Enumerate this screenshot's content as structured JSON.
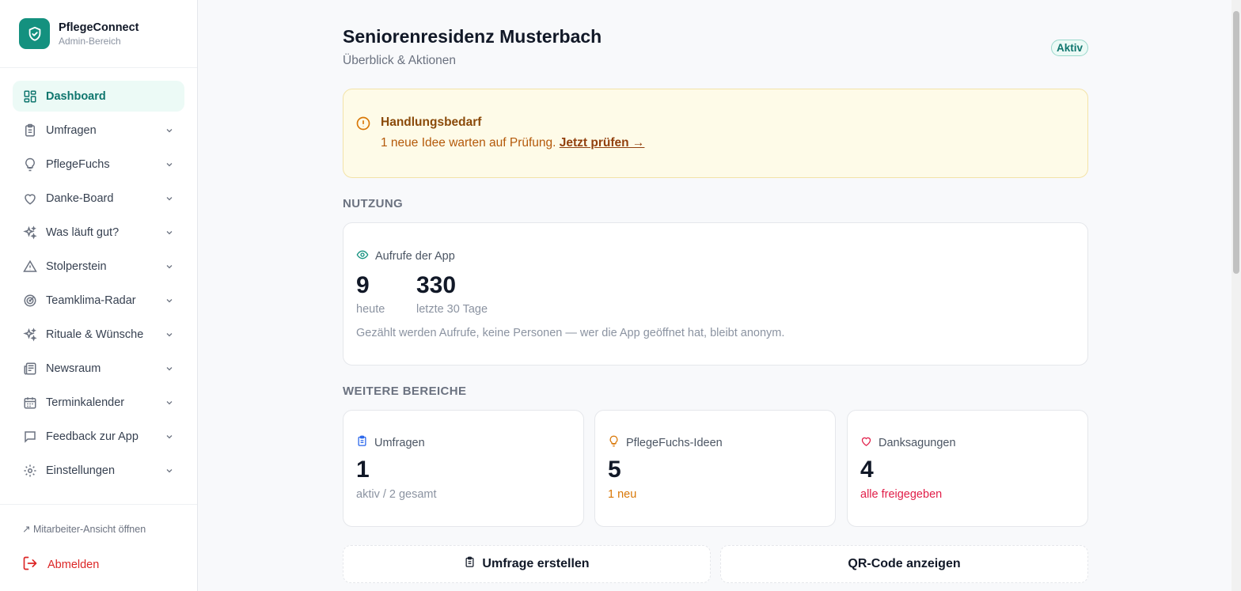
{
  "brand": {
    "title": "PflegeConnect",
    "subtitle": "Admin-Bereich"
  },
  "nav": {
    "items": [
      {
        "label": "Dashboard",
        "icon": "dashboard-icon",
        "active": true
      },
      {
        "label": "Umfragen",
        "icon": "clipboard-icon"
      },
      {
        "label": "PflegeFuchs",
        "icon": "lightbulb-icon"
      },
      {
        "label": "Danke-Board",
        "icon": "heart-icon"
      },
      {
        "label": "Was läuft gut?",
        "icon": "sparkles-icon"
      },
      {
        "label": "Stolperstein",
        "icon": "warning-icon"
      },
      {
        "label": "Teamklima-Radar",
        "icon": "radar-icon"
      },
      {
        "label": "Rituale & Wünsche",
        "icon": "sparkles-icon"
      },
      {
        "label": "Newsraum",
        "icon": "newspaper-icon"
      },
      {
        "label": "Terminkalender",
        "icon": "calendar-icon"
      },
      {
        "label": "Feedback zur App",
        "icon": "chat-icon"
      },
      {
        "label": "Einstellungen",
        "icon": "gear-icon"
      }
    ]
  },
  "sidebar_bottom": {
    "staff_view": "↗ Mitarbeiter-Ansicht öffnen",
    "logout": "Abmelden"
  },
  "header": {
    "title": "Seniorenresidenz Musterbach",
    "subtitle": "Überblick & Aktionen",
    "status": "Aktiv"
  },
  "alert": {
    "title": "Handlungsbedarf",
    "text": "1 neue Idee warten auf Prüfung.",
    "link": "Jetzt prüfen →"
  },
  "usage": {
    "heading": "NUTZUNG",
    "label": "Aufrufe der App",
    "today_value": "9",
    "today_caption": "heute",
    "month_value": "330",
    "month_caption": "letzte 30 Tage",
    "note": "Gezählt werden Aufrufe, keine Personen — wer die App geöffnet hat, bleibt anonym."
  },
  "areas": {
    "heading": "WEITERE BEREICHE",
    "cards": [
      {
        "label": "Umfragen",
        "value": "1",
        "sub": "aktiv / 2 gesamt",
        "color": "#8b93a1",
        "icon": "clipboard-icon"
      },
      {
        "label": "PflegeFuchs-Ideen",
        "value": "5",
        "sub": "1 neu",
        "color": "#d97706",
        "icon": "lightbulb-icon"
      },
      {
        "label": "Danksagungen",
        "value": "4",
        "sub": "alle freigegeben",
        "color": "#e11d48",
        "icon": "heart-icon"
      }
    ]
  },
  "actions": {
    "create_survey": "Umfrage erstellen",
    "show_qr": "QR-Code anzeigen"
  },
  "colors": {
    "accent": "#14917f",
    "danger": "#dc2626",
    "warning_bg": "#fefbe8"
  }
}
